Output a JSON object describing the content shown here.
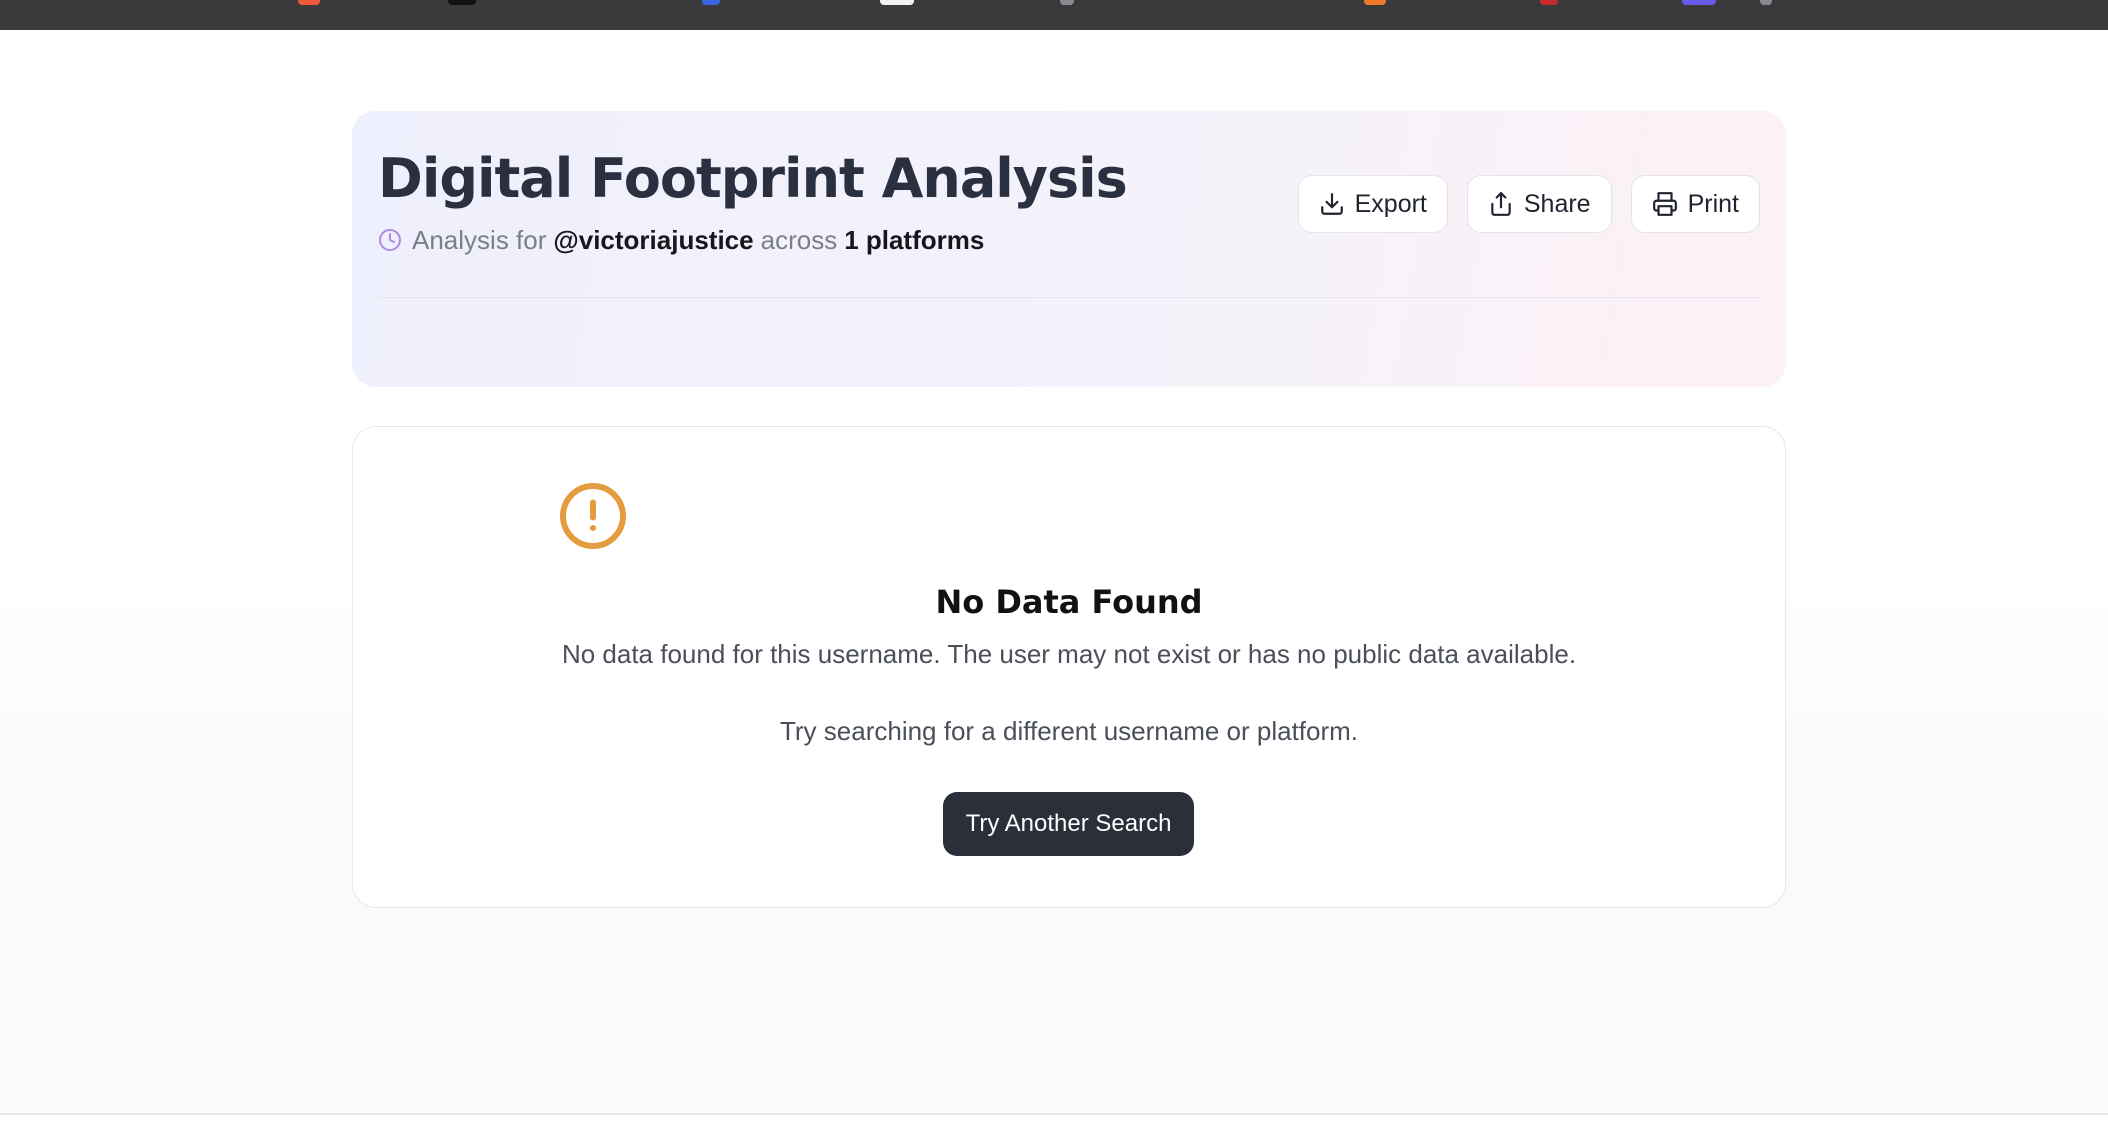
{
  "header": {
    "title": "Digital Footprint Analysis",
    "subtitle": {
      "prefix": "Analysis for",
      "username": "@victoriajustice",
      "middle": "across",
      "platforms": "1 platforms"
    },
    "actions": {
      "export_label": "Export",
      "share_label": "Share",
      "print_label": "Print"
    }
  },
  "result": {
    "title": "No Data Found",
    "message": "No data found for this username. The user may not exist or has no public data available.",
    "hint": "Try searching for a different username or platform.",
    "button_label": "Try Another Search"
  },
  "colors": {
    "title_text": "#2b3040",
    "alert_icon": "#e49c3f",
    "clock_icon": "#b08be0",
    "primary_button": "#2b2f3a"
  },
  "icons": {
    "subtitle": "clock-icon",
    "export": "download-icon",
    "share": "share-icon",
    "print": "printer-icon",
    "result": "alert-circle-icon"
  }
}
